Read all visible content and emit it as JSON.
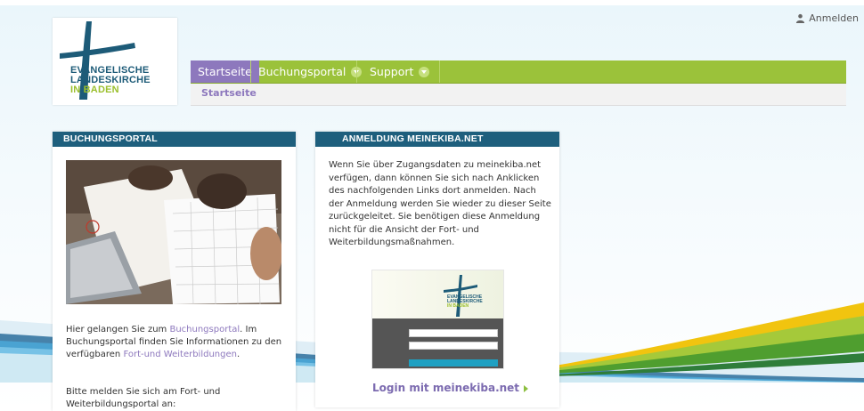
{
  "header": {
    "login_label": "Anmelden",
    "logo_lines": [
      "EVANGELISCHE",
      "LANDESKIRCHE",
      "IN BADEN"
    ]
  },
  "nav": {
    "items": [
      {
        "label": "Startseite",
        "active": true
      },
      {
        "label": "Buchungsportal",
        "dropdown": true
      },
      {
        "label": "Support",
        "dropdown": true
      }
    ],
    "breadcrumb": "Startseite"
  },
  "panels": {
    "buchungsportal": {
      "title": "BUCHUNGSPORTAL",
      "text_before": "Hier gelangen Sie zum ",
      "link1": "Buchungsportal",
      "text_mid": ". Im Buchungsportal finden Sie Informationen zu den verfügbaren ",
      "link2": "Fort-und Weiterbildungen",
      "text_after": ".",
      "text2": "Bitte melden Sie sich am Fort- und Weiterbildungsportal an:"
    },
    "anmeldung": {
      "title": "ANMELDUNG MEINEKIBA.NET",
      "text": "Wenn Sie über Zugangsdaten zu meinekiba.net verfügen, dann können Sie sich nach Anklicken des nachfolgenden Links dort anmelden. Nach der Anmeldung werden Sie wieder zu dieser Seite zurückgeleitet. Sie benötigen diese Anmeldung nicht für die Ansicht der Fort- und Weiterbildungsmaßnahmen.",
      "login_link": "Login mit meinekiba.net"
    }
  },
  "colors": {
    "nav_green": "#9bc23a",
    "active_purple": "#8d78bd",
    "panel_header": "#1e5f7d"
  },
  "icons": {
    "login": "user-icon",
    "nav_dropdown": "chevron-down-icon",
    "login_arrow": "triangle-right-icon"
  }
}
